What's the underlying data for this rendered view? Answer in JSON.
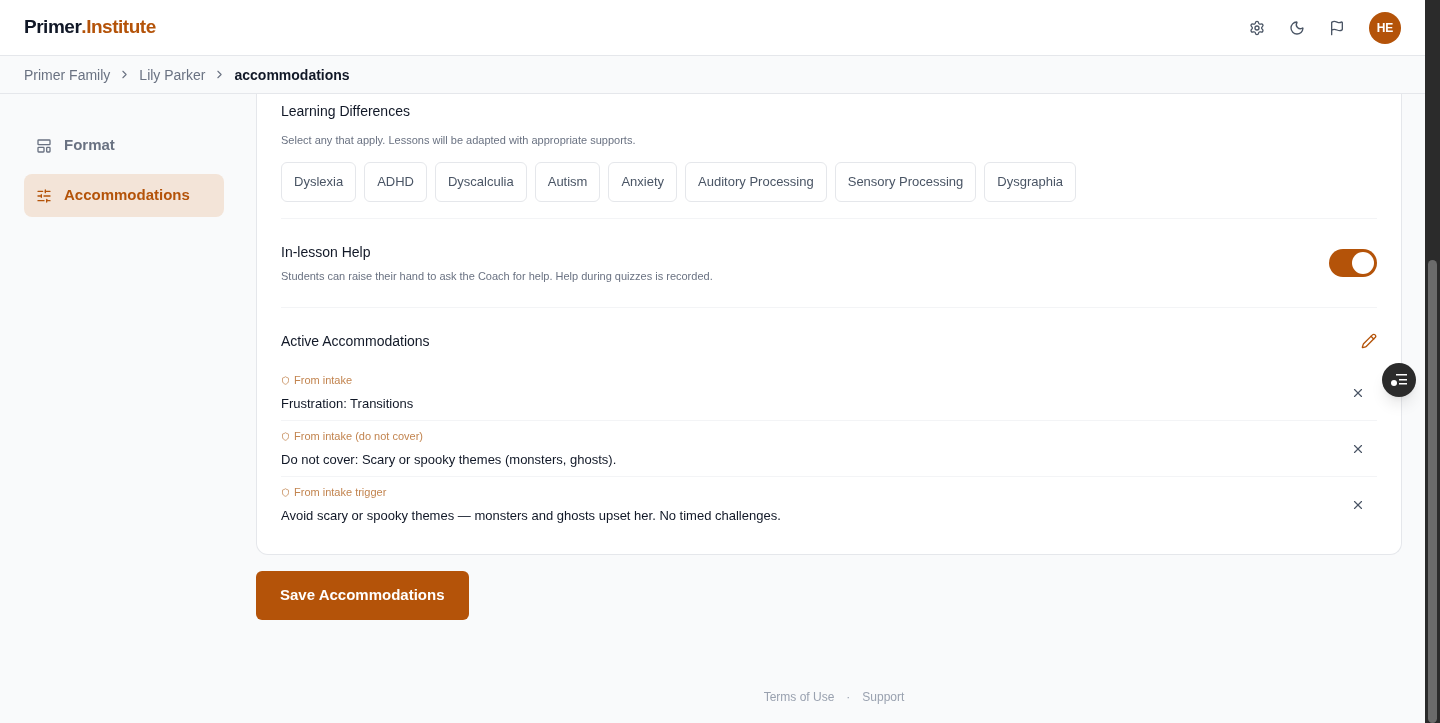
{
  "brand": {
    "name": "Primer",
    "suffix": ".Institute"
  },
  "header": {
    "avatar": "HE"
  },
  "breadcrumb": [
    {
      "label": "Primer Family",
      "current": false
    },
    {
      "label": "Lily Parker",
      "current": false
    },
    {
      "label": "accommodations",
      "current": true
    }
  ],
  "sidebar": {
    "items": [
      {
        "label": "Format",
        "selected": false
      },
      {
        "label": "Accommodations",
        "selected": true
      }
    ]
  },
  "learning_differences": {
    "title": "Learning Differences",
    "description": "Select any that apply. Lessons will be adapted with appropriate supports.",
    "options": [
      {
        "label": "Dyslexia",
        "selected": false
      },
      {
        "label": "ADHD",
        "selected": false
      },
      {
        "label": "Dyscalculia",
        "selected": false
      },
      {
        "label": "Autism",
        "selected": false
      },
      {
        "label": "Anxiety",
        "selected": false
      },
      {
        "label": "Auditory Processing",
        "selected": false
      },
      {
        "label": "Sensory Processing",
        "selected": false
      },
      {
        "label": "Dysgraphia",
        "selected": false
      }
    ]
  },
  "in_lesson_help": {
    "title": "In-lesson Help",
    "description": "Students can raise their hand to ask the Coach for help. Help during quizzes is recorded.",
    "on": true
  },
  "active_accommodations": {
    "title": "Active Accommodations",
    "items": [
      {
        "source": "From intake",
        "text": "Frustration: Transitions"
      },
      {
        "source": "From intake (do not cover)",
        "text": "Do not cover: Scary or spooky themes (monsters, ghosts)."
      },
      {
        "source": "From intake trigger",
        "text": "Avoid scary or spooky themes — monsters and ghosts upset her. No timed challenges."
      }
    ]
  },
  "save_button": "Save Accommodations",
  "footer": {
    "links": [
      "Terms of Use",
      "Support"
    ],
    "separator": "·"
  }
}
